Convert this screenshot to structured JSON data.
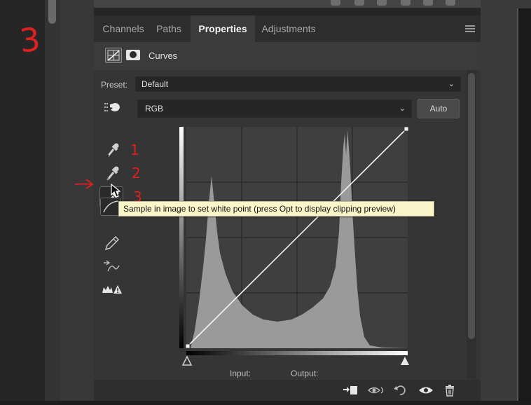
{
  "annotations": {
    "big_number": "3",
    "tool_numbers": [
      "1",
      "2",
      "3"
    ]
  },
  "panel": {
    "tabs": [
      {
        "label": "Channels",
        "active": false
      },
      {
        "label": "Paths",
        "active": false
      },
      {
        "label": "Properties",
        "active": true
      },
      {
        "label": "Adjustments",
        "active": false
      }
    ],
    "title": "Curves",
    "preset": {
      "label": "Preset:",
      "value": "Default"
    },
    "channel": {
      "value": "RGB"
    },
    "auto_label": "Auto",
    "input_label": "Input:",
    "output_label": "Output:",
    "tooltip": "Sample in image to set white point (press Opt to display clipping preview)"
  },
  "tools": [
    {
      "name": "black-point-eyedropper",
      "icon": "eyedropper-icon"
    },
    {
      "name": "gray-point-eyedropper",
      "icon": "eyedropper-icon"
    },
    {
      "name": "white-point-eyedropper",
      "icon": "eyedropper-icon",
      "active": true
    },
    {
      "name": "edit-points-curve-tool",
      "icon": "curve-icon"
    },
    {
      "name": "draw-curve-tool",
      "icon": "pencil-icon"
    },
    {
      "name": "smooth-curve-tool",
      "icon": "smooth-icon"
    },
    {
      "name": "clipping-warning-tool",
      "icon": "warning-icon"
    }
  ],
  "footer_icons": [
    "clip-to-layer-icon",
    "view-previous-icon",
    "reset-icon",
    "visibility-icon",
    "trash-icon"
  ],
  "colors": {
    "annotation_red": "#e02020",
    "tooltip_bg": "#fbf6c9",
    "panel_bg": "#353535"
  }
}
